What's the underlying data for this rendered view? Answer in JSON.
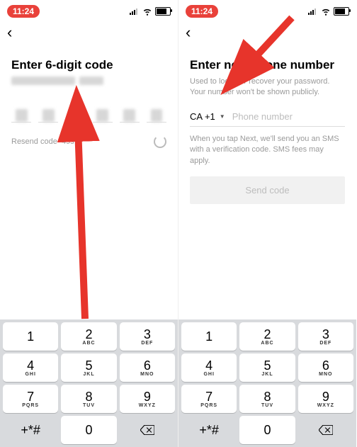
{
  "status": {
    "time": "11:24"
  },
  "left": {
    "title": "Enter 6-digit code",
    "resend_label": "Resend code",
    "resend_time": "49s"
  },
  "right": {
    "title": "Enter new phone number",
    "subtitle": "Used to log in or recover your password. Your number won't be shown publicly.",
    "cc": "CA +1",
    "placeholder": "Phone number",
    "info": "When you tap Next, we'll send you an SMS with a verification code. SMS fees may apply.",
    "button": "Send code"
  },
  "keypad": [
    {
      "n": "1",
      "l": ""
    },
    {
      "n": "2",
      "l": "ABC"
    },
    {
      "n": "3",
      "l": "DEF"
    },
    {
      "n": "4",
      "l": "GHI"
    },
    {
      "n": "5",
      "l": "JKL"
    },
    {
      "n": "6",
      "l": "MNO"
    },
    {
      "n": "7",
      "l": "PQRS"
    },
    {
      "n": "8",
      "l": "TUV"
    },
    {
      "n": "9",
      "l": "WXYZ"
    },
    {
      "n": "+*#",
      "l": ""
    },
    {
      "n": "0",
      "l": ""
    }
  ]
}
